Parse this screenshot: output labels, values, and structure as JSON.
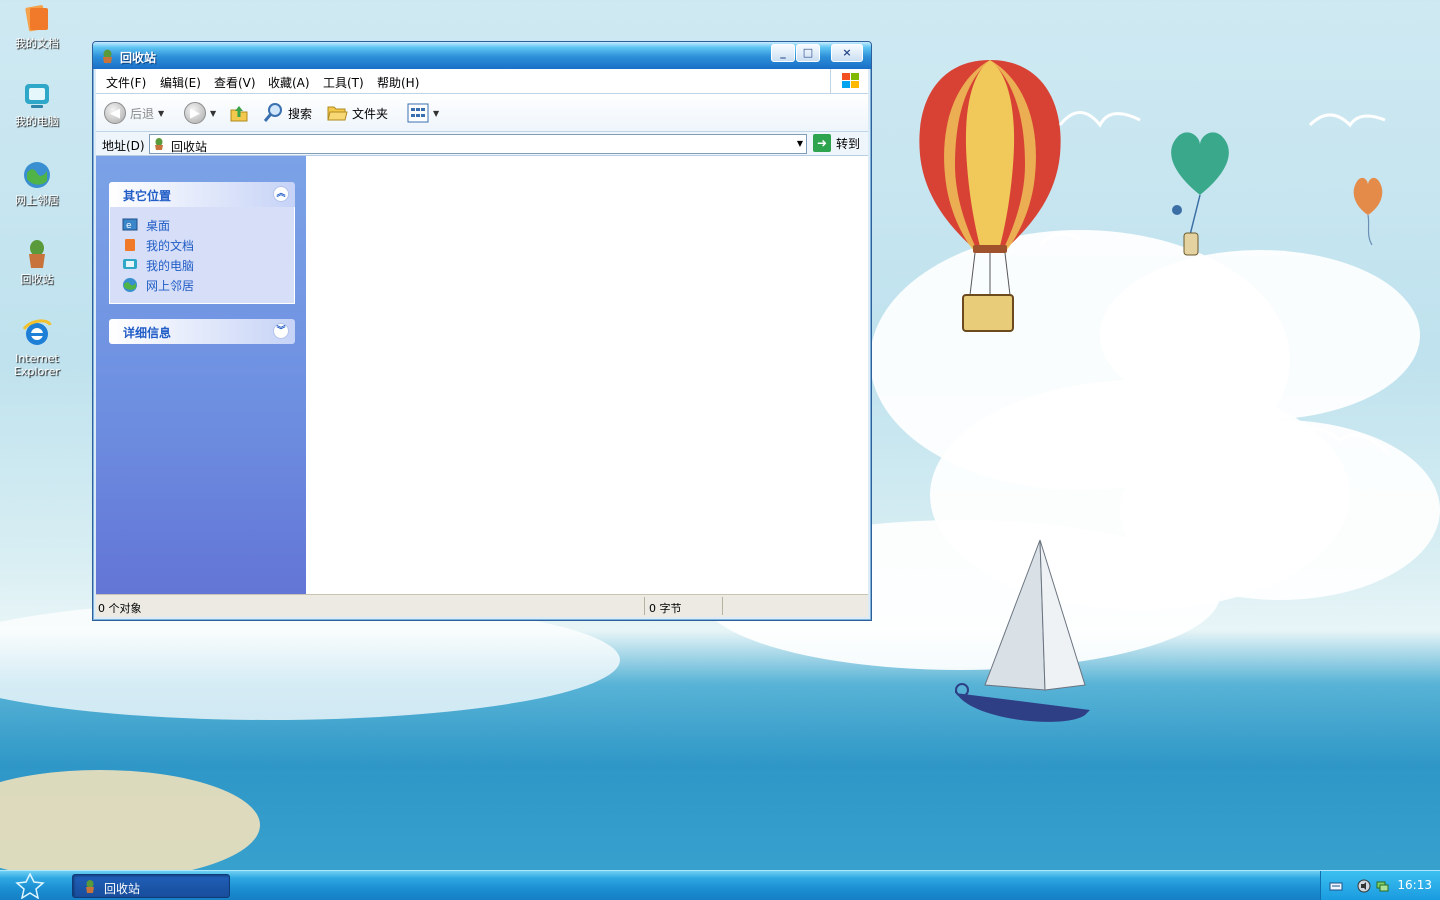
{
  "desktop": {
    "icons": [
      {
        "label": "我的文档",
        "icon": "my-documents-icon"
      },
      {
        "label": "我的电脑",
        "icon": "my-computer-icon"
      },
      {
        "label": "网上邻居",
        "icon": "network-places-icon"
      },
      {
        "label": "回收站",
        "icon": "recycle-bin-icon"
      },
      {
        "label": "Internet Explorer",
        "icon": "internet-explorer-icon"
      }
    ]
  },
  "window": {
    "title": "回收站",
    "controls": {
      "minimize": "_",
      "maximize": "□",
      "close": "×"
    },
    "menu": [
      "文件(F)",
      "编辑(E)",
      "查看(V)",
      "收藏(A)",
      "工具(T)",
      "帮助(H)"
    ],
    "toolbar": {
      "back": "后退",
      "search": "搜索",
      "folders": "文件夹"
    },
    "address": {
      "label": "地址(D)",
      "value": "回收站",
      "go": "转到"
    },
    "taskpane": {
      "other_places": {
        "title": "其它位置",
        "links": [
          "桌面",
          "我的文档",
          "我的电脑",
          "网上邻居"
        ]
      },
      "details": {
        "title": "详细信息"
      }
    },
    "status": {
      "objects": "0 个对象",
      "size": "0 字节"
    }
  },
  "taskbar": {
    "items": [
      {
        "label": "回收站"
      }
    ],
    "clock": "16:13"
  },
  "colors": {
    "link": "#215dc6",
    "titlebar": "#1a6fc8",
    "taskbar": "#1b8fd2"
  }
}
